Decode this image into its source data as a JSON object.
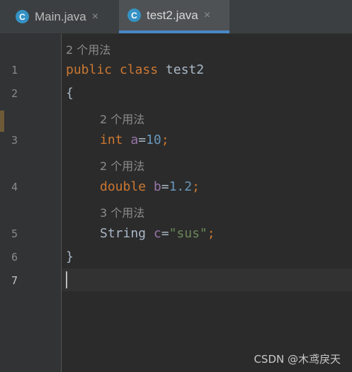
{
  "tabs": [
    {
      "label": "Main.java",
      "icon": "java-class-icon",
      "active": false
    },
    {
      "label": "test2.java",
      "icon": "java-class-icon",
      "active": true
    }
  ],
  "tab_close_symbol": "×",
  "class_icon_letter": "C",
  "usage_hints": {
    "class_hint": "2 个用法",
    "a_hint": "2 个用法",
    "b_hint": "2 个用法",
    "c_hint": "3 个用法"
  },
  "line_numbers": [
    "1",
    "2",
    "3",
    "4",
    "5",
    "6",
    "7"
  ],
  "code": {
    "line1": {
      "kw_public": "public",
      "kw_class": "class",
      "name": "test2"
    },
    "line2": {
      "brace": "{"
    },
    "line3": {
      "type": "int",
      "var": "a",
      "eq": "=",
      "value": "10",
      "semi": ";"
    },
    "line4": {
      "type": "double",
      "var": "b",
      "eq": "=",
      "value": "1.2",
      "semi": ";"
    },
    "line5": {
      "type": "String",
      "var": "c",
      "eq": "=",
      "value": "\"sus\"",
      "semi": ";"
    },
    "line6": {
      "brace": "}"
    }
  },
  "colors": {
    "editor_bg": "#2b2b2b",
    "keyword": "#cc7832",
    "variable": "#9876aa",
    "number": "#6897bb",
    "string": "#6a8759",
    "text": "#a9b7c6",
    "tab_underline": "#4a88c7"
  },
  "watermark": "CSDN @木鸢戾天"
}
